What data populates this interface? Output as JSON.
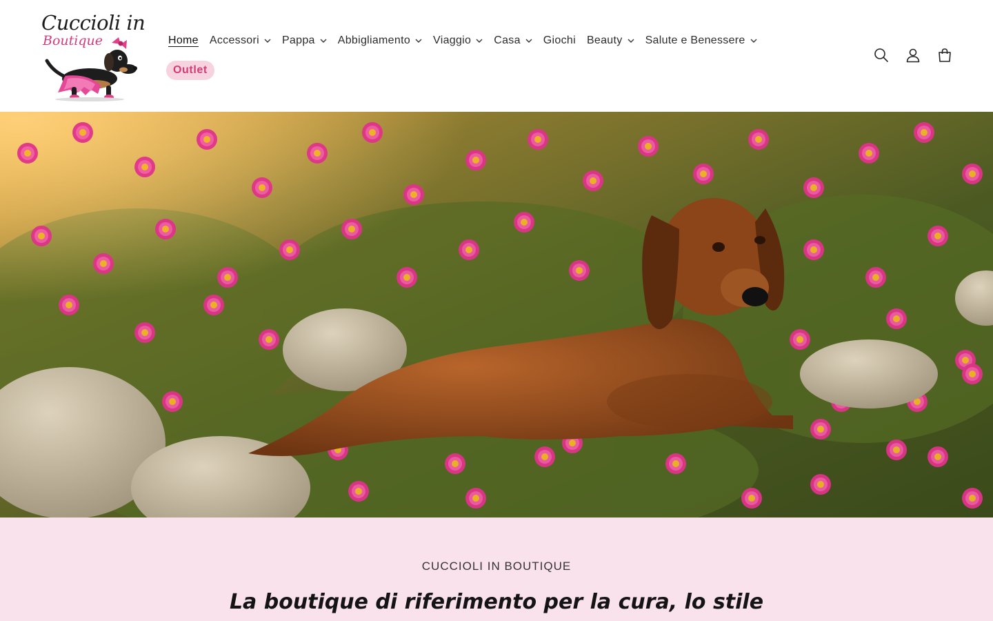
{
  "header": {
    "logo": {
      "line1": "Cuccioli in",
      "line2": "Boutique"
    },
    "nav": [
      {
        "label": "Home",
        "dropdown": false,
        "active": true
      },
      {
        "label": "Accessori",
        "dropdown": true
      },
      {
        "label": "Pappa",
        "dropdown": true
      },
      {
        "label": "Abbigliamento",
        "dropdown": true
      },
      {
        "label": "Viaggio",
        "dropdown": true
      },
      {
        "label": "Casa",
        "dropdown": true
      },
      {
        "label": "Giochi",
        "dropdown": false
      },
      {
        "label": "Beauty",
        "dropdown": true
      },
      {
        "label": "Salute e Benessere",
        "dropdown": true
      }
    ],
    "outlet_label": "Outlet",
    "icons": [
      "search-icon",
      "account-icon",
      "cart-icon"
    ]
  },
  "hero": {
    "image_subject": "dachshund-in-flower-field"
  },
  "banner": {
    "eyebrow": "CUCCIOLI IN BOUTIQUE",
    "headline": "La boutique di riferimento per la cura, lo stile e il benessere dei tuoi cuccioli"
  },
  "colors": {
    "accent_pink": "#d43c73",
    "outlet_bg": "#f6d3df",
    "banner_bg": "#fae2ec",
    "text_dark": "#2b2b2b"
  }
}
